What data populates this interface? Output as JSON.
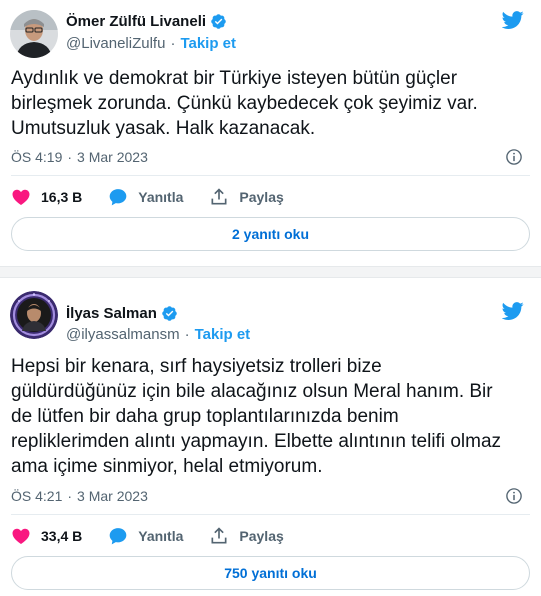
{
  "tweets": [
    {
      "author": {
        "name": "Ömer Zülfü Livaneli",
        "handle": "@LivaneliZulfu",
        "follow_label": "Takip et"
      },
      "text": "Aydınlık ve demokrat bir Türkiye isteyen bütün güçler\nbirleşmek zorunda. Çünkü kaybedecek çok şeyimiz var.\nUmutsuzluk yasak. Halk kazanacak.",
      "time": "ÖS 4:19",
      "date": "3 Mar 2023",
      "likes": "16,3 B",
      "reply_label": "Yanıtla",
      "share_label": "Paylaş",
      "read_replies": "2 yanıtı oku"
    },
    {
      "author": {
        "name": "İlyas Salman",
        "handle": "@ilyassalmansm",
        "follow_label": "Takip et"
      },
      "text": "Hepsi bir kenara, sırf haysiyetsiz trolleri bize\ngüldürdüğünüz için bile alacağınız olsun Meral hanım. Bir\nde lütfen bir daha grup toplantılarınızda benim\nrepliklerimden alıntı yapmayın. Elbette alıntının telifi olmaz\nama içime sinmiyor, helal etmiyorum.",
      "time": "ÖS 4:21",
      "date": "3 Mar 2023",
      "likes": "33,4 B",
      "reply_label": "Yanıtla",
      "share_label": "Paylaş",
      "read_replies": "750 yanıtı oku"
    }
  ],
  "colors": {
    "accent": "#1d9bf0",
    "like": "#f91880",
    "text": "#0f1419",
    "muted": "#536471"
  },
  "icons": [
    "verified-badge-icon",
    "twitter-bird-icon",
    "info-icon",
    "heart-icon",
    "reply-bubble-icon",
    "share-icon"
  ]
}
